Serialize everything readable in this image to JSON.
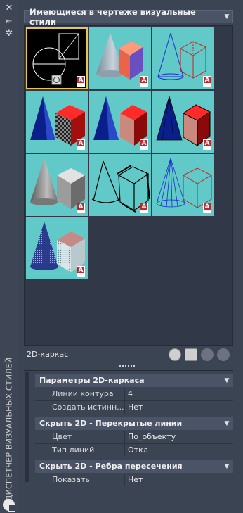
{
  "palette": {
    "title": "ДИСПЕТЧЕР ВИЗУАЛЬНЫХ СТИЛЕЙ",
    "close_icon": "close-icon",
    "autohide_icon": "autohide-icon",
    "properties_icon": "gear-icon"
  },
  "header": {
    "title": "Имеющиеся в чертеже визуальные стили"
  },
  "gallery": {
    "badge_letter": "A",
    "tiles": [
      {
        "name": "2d-wireframe"
      },
      {
        "name": "realistic"
      },
      {
        "name": "wireframe"
      },
      {
        "name": "shaded-checker"
      },
      {
        "name": "shaded"
      },
      {
        "name": "shaded-with-edges"
      },
      {
        "name": "shades-of-gray"
      },
      {
        "name": "sketchy"
      },
      {
        "name": "wireframe-blue-red"
      },
      {
        "name": "x-ray"
      }
    ]
  },
  "footer": {
    "current_style": "2D-каркас"
  },
  "properties": {
    "sections": [
      {
        "title": "Параметры 2D-каркаса",
        "rows": [
          {
            "label": "Линии контура",
            "value": "4"
          },
          {
            "label": "Создать истинн...",
            "value": "Нет"
          }
        ]
      },
      {
        "title": "Скрыть 2D - Перекрытые линии",
        "rows": [
          {
            "label": "Цвет",
            "value": "По_объекту"
          },
          {
            "label": "Тип линий",
            "value": "Откл"
          }
        ]
      },
      {
        "title": "Скрыть 2D - Ребра пересечения",
        "rows": [
          {
            "label": "Показать",
            "value": "Нет"
          }
        ]
      }
    ]
  },
  "colors": {
    "tile_bg": "#62c9c9",
    "selection": "#e6c84a",
    "badge": "#c1272d",
    "panel_bg": "#3b4453"
  }
}
